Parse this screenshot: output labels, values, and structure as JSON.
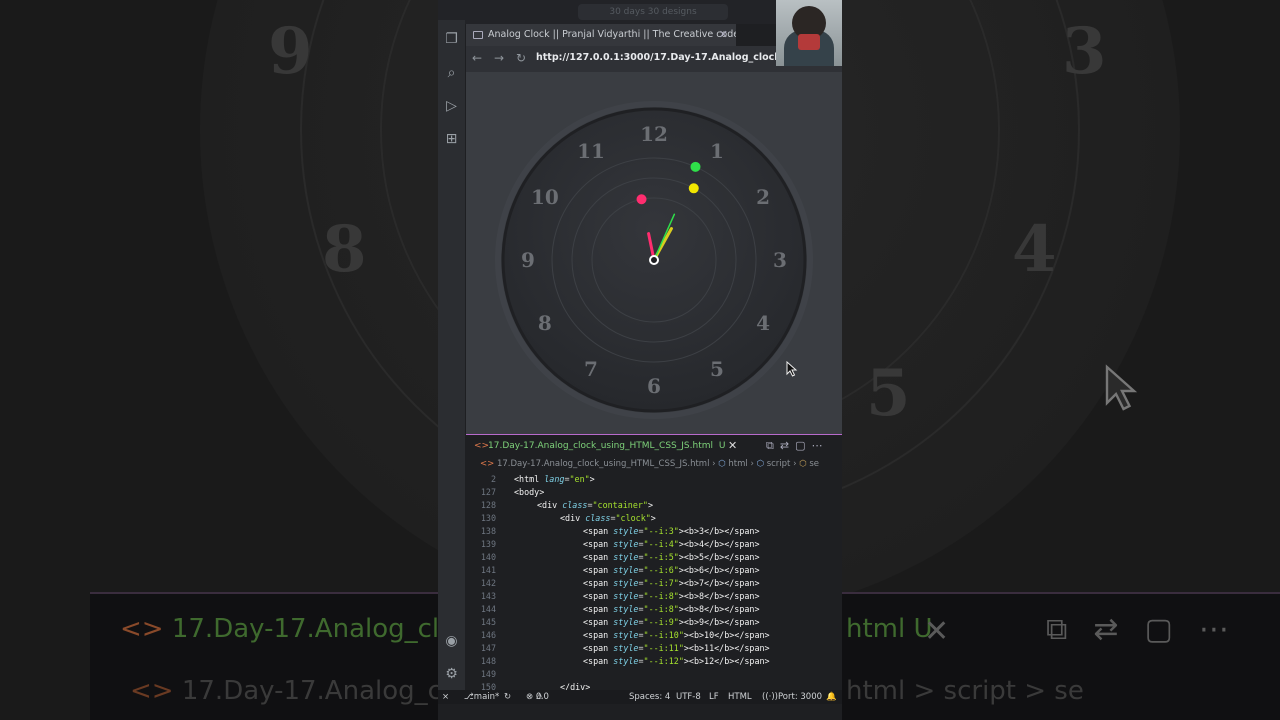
{
  "background": {
    "numbers": [
      "9",
      "3",
      "8",
      "4",
      "5"
    ],
    "strip_filename": "17.Day-17.Analog_clo",
    "strip_tail": "html U",
    "strip_breadcrumb_start": "17.Day-17.Analog_c",
    "strip_breadcrumb_end": "html > script > se"
  },
  "top": {
    "search_placeholder": "30 days 30 designs"
  },
  "browser": {
    "tab_title": "Analog Clock || Pranjal Vidyarthi || The Creative coder",
    "url": "http://127.0.0.1:3000/17.Day-17.Analog_clock_using_HTML"
  },
  "clock": {
    "numbers": [
      "12",
      "1",
      "2",
      "3",
      "4",
      "5",
      "6",
      "7",
      "8",
      "9",
      "10",
      "11"
    ],
    "time": {
      "hour": 12,
      "minute": 58,
      "second": 4
    },
    "dot_colors": {
      "second": "#2fe04a",
      "minute": "#ff2d6f",
      "hour": "#f2e600"
    },
    "hand_colors": {
      "second": "#2fe04a",
      "minute": "#ff2d6f",
      "hour": "#d9cc1f"
    },
    "face_color": "#2e3034"
  },
  "editor": {
    "tab_filename": "17.Day-17.Analog_clock_using_HTML_CSS_JS.html",
    "tab_status": "U",
    "breadcrumb": [
      "17.Day-17.Analog_clock_using_HTML_CSS_JS.html",
      "html",
      "script",
      "se"
    ],
    "lines": [
      {
        "n": "2",
        "indent": 0,
        "parts": [
          [
            "tg",
            "<html "
          ],
          [
            "at",
            "lang"
          ],
          [
            "pl",
            "="
          ],
          [
            "sv",
            "\"en\""
          ],
          [
            "tg",
            ">"
          ]
        ]
      },
      {
        "n": "127",
        "indent": 0,
        "parts": [
          [
            "tg",
            "<body>"
          ]
        ]
      },
      {
        "n": "128",
        "indent": 1,
        "parts": [
          [
            "tg",
            "<div "
          ],
          [
            "at",
            "class"
          ],
          [
            "pl",
            "="
          ],
          [
            "sv",
            "\"container\""
          ],
          [
            "tg",
            ">"
          ]
        ]
      },
      {
        "n": "130",
        "indent": 2,
        "parts": [
          [
            "tg",
            "<div "
          ],
          [
            "at",
            "class"
          ],
          [
            "pl",
            "="
          ],
          [
            "sv",
            "\"clock\""
          ],
          [
            "tg",
            ">"
          ]
        ]
      },
      {
        "n": "138",
        "indent": 3,
        "parts": [
          [
            "tg",
            "<span "
          ],
          [
            "at",
            "style"
          ],
          [
            "pl",
            "="
          ],
          [
            "sv",
            "\"--i:3\""
          ],
          [
            "tg",
            "><b>3</b></span>"
          ]
        ]
      },
      {
        "n": "139",
        "indent": 3,
        "parts": [
          [
            "tg",
            "<span "
          ],
          [
            "at",
            "style"
          ],
          [
            "pl",
            "="
          ],
          [
            "sv",
            "\"--i:4\""
          ],
          [
            "tg",
            "><b>4</b></span>"
          ]
        ]
      },
      {
        "n": "140",
        "indent": 3,
        "parts": [
          [
            "tg",
            "<span "
          ],
          [
            "at",
            "style"
          ],
          [
            "pl",
            "="
          ],
          [
            "sv",
            "\"--i:5\""
          ],
          [
            "tg",
            "><b>5</b></span>"
          ]
        ]
      },
      {
        "n": "141",
        "indent": 3,
        "parts": [
          [
            "tg",
            "<span "
          ],
          [
            "at",
            "style"
          ],
          [
            "pl",
            "="
          ],
          [
            "sv",
            "\"--i:6\""
          ],
          [
            "tg",
            "><b>6</b></span>"
          ]
        ]
      },
      {
        "n": "142",
        "indent": 3,
        "parts": [
          [
            "tg",
            "<span "
          ],
          [
            "at",
            "style"
          ],
          [
            "pl",
            "="
          ],
          [
            "sv",
            "\"--i:7\""
          ],
          [
            "tg",
            "><b>7</b></span>"
          ]
        ]
      },
      {
        "n": "143",
        "indent": 3,
        "parts": [
          [
            "tg",
            "<span "
          ],
          [
            "at",
            "style"
          ],
          [
            "pl",
            "="
          ],
          [
            "sv",
            "\"--i:8\""
          ],
          [
            "tg",
            "><b>8</b></span>"
          ]
        ]
      },
      {
        "n": "144",
        "indent": 3,
        "parts": [
          [
            "tg",
            "<span "
          ],
          [
            "at",
            "style"
          ],
          [
            "pl",
            "="
          ],
          [
            "sv",
            "\"--i:8\""
          ],
          [
            "tg",
            "><b>8</b></span>"
          ]
        ]
      },
      {
        "n": "145",
        "indent": 3,
        "parts": [
          [
            "tg",
            "<span "
          ],
          [
            "at",
            "style"
          ],
          [
            "pl",
            "="
          ],
          [
            "sv",
            "\"--i:9\""
          ],
          [
            "tg",
            "><b>9</b></span>"
          ]
        ]
      },
      {
        "n": "146",
        "indent": 3,
        "parts": [
          [
            "tg",
            "<span "
          ],
          [
            "at",
            "style"
          ],
          [
            "pl",
            "="
          ],
          [
            "sv",
            "\"--i:10\""
          ],
          [
            "tg",
            "><b>10</b></span>"
          ]
        ]
      },
      {
        "n": "147",
        "indent": 3,
        "parts": [
          [
            "tg",
            "<span "
          ],
          [
            "at",
            "style"
          ],
          [
            "pl",
            "="
          ],
          [
            "sv",
            "\"--i:11\""
          ],
          [
            "tg",
            "><b>11</b></span>"
          ]
        ]
      },
      {
        "n": "148",
        "indent": 3,
        "parts": [
          [
            "tg",
            "<span "
          ],
          [
            "at",
            "style"
          ],
          [
            "pl",
            "="
          ],
          [
            "sv",
            "\"--i:12\""
          ],
          [
            "tg",
            "><b>12</b></span>"
          ]
        ]
      },
      {
        "n": "149",
        "indent": 3,
        "parts": []
      },
      {
        "n": "150",
        "indent": 2,
        "parts": [
          [
            "tg",
            "</div>"
          ]
        ]
      }
    ]
  },
  "status": {
    "branch": "main*",
    "errors": "0",
    "warnings": "0",
    "spaces": "Spaces: 4",
    "encoding": "UTF-8",
    "eol": "LF",
    "language": "HTML",
    "port": "Port: 3000"
  }
}
